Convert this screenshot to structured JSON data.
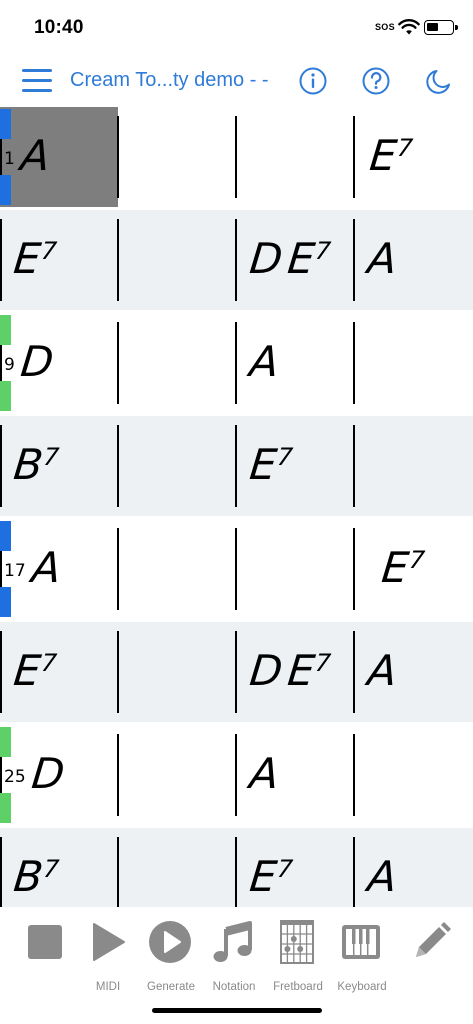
{
  "status_bar": {
    "time": "10:40",
    "sos": "SOS",
    "icons": [
      "wifi-icon",
      "battery-icon"
    ]
  },
  "nav": {
    "title": "Cream To...ty demo - -",
    "icons": [
      "hamburger-menu-icon",
      "info-icon",
      "help-icon",
      "moon-icon"
    ],
    "accent_color": "#2f7bd8"
  },
  "grid": {
    "rows": [
      {
        "bar_number": "1",
        "marker_color": "#1e6fe0",
        "chords": [
          {
            "name": "A",
            "cell": 0,
            "offset": 0
          },
          {
            "name": "E7",
            "cell": 3,
            "offset": 0
          }
        ]
      },
      {
        "bar_number": "",
        "marker_color": "",
        "chords": [
          {
            "name": "E7",
            "cell": 0,
            "offset": 0
          },
          {
            "name": "D",
            "cell": 2,
            "offset": 0
          },
          {
            "name": "E7",
            "cell": 2,
            "offset": 1
          },
          {
            "name": "A",
            "cell": 3,
            "offset": 0
          }
        ]
      },
      {
        "bar_number": "9",
        "marker_color": "#5fd068",
        "chords": [
          {
            "name": "D",
            "cell": 0,
            "offset": 0
          },
          {
            "name": "A",
            "cell": 2,
            "offset": 0
          }
        ]
      },
      {
        "bar_number": "",
        "marker_color": "",
        "chords": [
          {
            "name": "B7",
            "cell": 0,
            "offset": 0
          },
          {
            "name": "E7",
            "cell": 2,
            "offset": 0
          }
        ]
      },
      {
        "bar_number": "17",
        "marker_color": "#1e6fe0",
        "chords": [
          {
            "name": "A",
            "cell": 0,
            "offset": 0
          },
          {
            "name": "E7",
            "cell": 3,
            "offset": 0
          }
        ]
      },
      {
        "bar_number": "",
        "marker_color": "",
        "chords": [
          {
            "name": "E7",
            "cell": 0,
            "offset": 0
          },
          {
            "name": "D",
            "cell": 2,
            "offset": 0
          },
          {
            "name": "E7",
            "cell": 2,
            "offset": 1
          },
          {
            "name": "A",
            "cell": 3,
            "offset": 0
          }
        ]
      },
      {
        "bar_number": "25",
        "marker_color": "#5fd068",
        "chords": [
          {
            "name": "D",
            "cell": 0,
            "offset": 0
          },
          {
            "name": "A",
            "cell": 2,
            "offset": 0
          }
        ]
      },
      {
        "bar_number": "",
        "marker_color": "",
        "chords": [
          {
            "name": "B7",
            "cell": 0,
            "offset": 0
          },
          {
            "name": "E7",
            "cell": 2,
            "offset": 0
          },
          {
            "name": "A",
            "cell": 3,
            "offset": 0
          }
        ]
      }
    ]
  },
  "toolbar": {
    "items": [
      {
        "label": "",
        "icon": "stop-icon"
      },
      {
        "label": "MIDI",
        "icon": "play-icon"
      },
      {
        "label": "Generate",
        "icon": "play-circle-icon"
      },
      {
        "label": "Notation",
        "icon": "music-note-icon"
      },
      {
        "label": "Fretboard",
        "icon": "fretboard-icon"
      },
      {
        "label": "Keyboard",
        "icon": "keyboard-icon"
      },
      {
        "label": "",
        "icon": "pencil-icon"
      }
    ],
    "icon_color": "#8a8a8a"
  }
}
